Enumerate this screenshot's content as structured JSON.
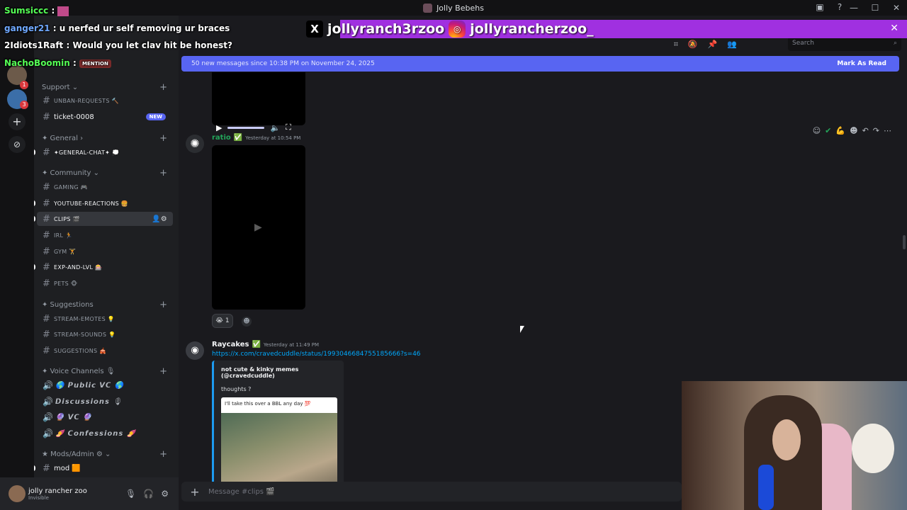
{
  "window": {
    "title": "Jolly Bebehs",
    "controls": [
      "—",
      "☐",
      "✕"
    ]
  },
  "overlay": {
    "chat": [
      {
        "user": "Sumsiccc",
        "sep": " :",
        "text": ""
      },
      {
        "user": "ganger21",
        "sep": " :",
        "text": " u nerfed ur self removing ur braces"
      },
      {
        "user": "2Idiots1Raft",
        "sep": " :",
        "text": " Would you let clav hit be honest?"
      },
      {
        "user": "NachoBoomin",
        "sep": " :",
        "text": ""
      }
    ],
    "x_handle": "jollyranch3rzoo",
    "ig_handle": "jollyrancherzoo_",
    "close": "✕"
  },
  "sidebar": {
    "categories": [
      {
        "label": "Support",
        "plus": "+"
      },
      {
        "label": "✦ General",
        "plus": "+"
      },
      {
        "label": "✦ Community",
        "plus": "+"
      },
      {
        "label": "✦ Suggestions",
        "plus": "+"
      },
      {
        "label": "✦ Voice Channels 🎙",
        "plus": "+"
      },
      {
        "label": "★ Mods/Admin ⚙",
        "plus": "+"
      }
    ],
    "channels": {
      "unban": "UNBAN-REQUESTS 🔨",
      "ticket": "ticket-0008",
      "ticket_badge": "NEW",
      "general": "✦GENERAL-CHAT✦ 💭",
      "gaming": "GAMING 🎮",
      "youtube": "YOUTUBE-REACTIONS 🍔",
      "clips": "CLIPS 🎬",
      "irl": "IRL 🏃",
      "gym": "GYM 🏋",
      "exp": "EXP-AND-LVL 🎰",
      "pets": "PETS 🐵",
      "stream_emotes": "STREAM-EMOTES 💡",
      "stream_sounds": "STREAM-SOUNDS 💡",
      "suggestions": "SUGGESTIONS 🎪",
      "public_vc": "🌎 𝙋𝙪𝙗𝙡𝙞𝙘 𝙑𝘾 🌎",
      "discussions": "𝘿𝙞𝙨𝙘𝙪𝙨𝙨𝙞𝙤𝙣𝙨 🎙",
      "vc": "🔮 𝙑𝘾 🔮",
      "confessions": "🍠 𝘾𝙤𝙣𝙛𝙚𝙨𝙨𝙞𝙤𝙣𝙨 🍠",
      "mod": "mod 🟧"
    },
    "mention": "MENTION"
  },
  "user": {
    "name": "jolly rancher zoo",
    "status": "Invisible"
  },
  "header": {
    "search_placeholder": "Search"
  },
  "new_messages": {
    "text": "50 new messages since 10:38 PM on November 24, 2025",
    "action": "Mark As Read"
  },
  "messages": [
    {
      "author": "ratio",
      "timestamp": "Yesterday at 10:54 PM",
      "reaction": "😭",
      "reaction_count": "1"
    },
    {
      "author": "Raycakes",
      "timestamp": "Yesterday at 11:49 PM",
      "link": "https://x.com/cravedcuddle/status/1993046684755185666?s=46",
      "embed_title": "not cute & kinky memes (@cravedcuddle)",
      "embed_text": "thoughts ?",
      "embed_image_caption": "I'll take this over a BBL any day 💯"
    }
  ],
  "composer": {
    "placeholder": "Message #clips 🎬"
  },
  "colors": {
    "accent": "#5865f2",
    "green_name": "#23a55a",
    "link": "#00a8fc",
    "strip": "#a030e0"
  }
}
